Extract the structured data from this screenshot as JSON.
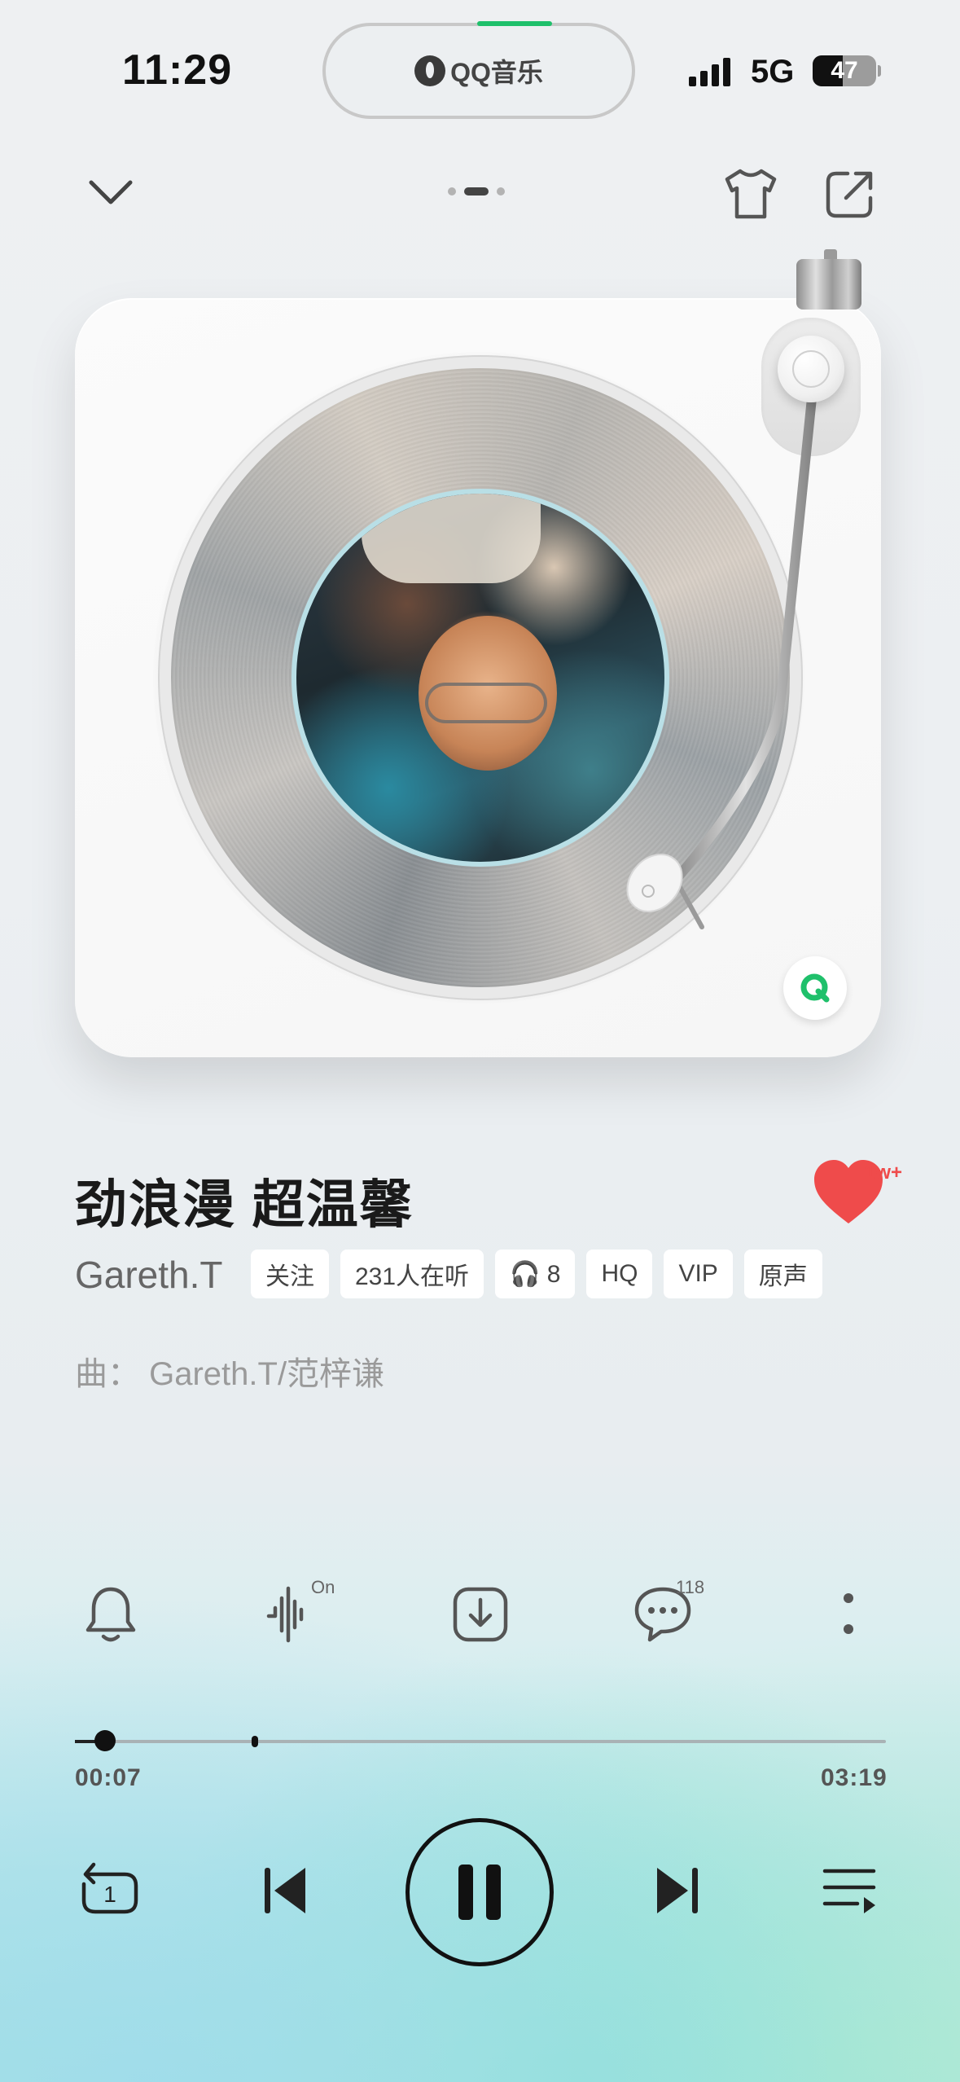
{
  "status_bar": {
    "time": "11:29",
    "island_app": "QQ音乐",
    "network": "5G",
    "battery": "47",
    "battery_level_percent": 47
  },
  "top_bar": {
    "collapse_icon": "chevron-down-icon",
    "skin_icon": "tshirt-icon",
    "share_icon": "share-icon",
    "page_indicator": {
      "count": 3,
      "active": 1
    }
  },
  "song": {
    "title": "劲浪漫 超温馨",
    "artist": "Gareth.T",
    "composer": "曲：  Gareth.T/范梓谦",
    "liked": true,
    "like_count": "1w+",
    "tags": [
      "关注",
      "231人在听",
      "🎧 8",
      "HQ",
      "VIP",
      "原声"
    ]
  },
  "actions": {
    "ring_icon": "bell-icon",
    "effect_badge": "On",
    "effect_icon": "sound-wave-icon",
    "download_icon": "download-icon",
    "comment_count": "118",
    "comment_icon": "comment-icon",
    "more_icon": "more-vertical-icon"
  },
  "progress": {
    "current": "00:07",
    "total": "03:19",
    "played_fraction": 0.037
  },
  "controls": {
    "repeat_mode": "1",
    "repeat_icon": "repeat-one-icon",
    "prev_icon": "previous-track-icon",
    "play_state_icon": "pause-icon",
    "next_icon": "next-track-icon",
    "playlist_icon": "playlist-icon"
  },
  "colors": {
    "accent_green": "#1fc06b",
    "heart_red": "#ef4b4b"
  }
}
